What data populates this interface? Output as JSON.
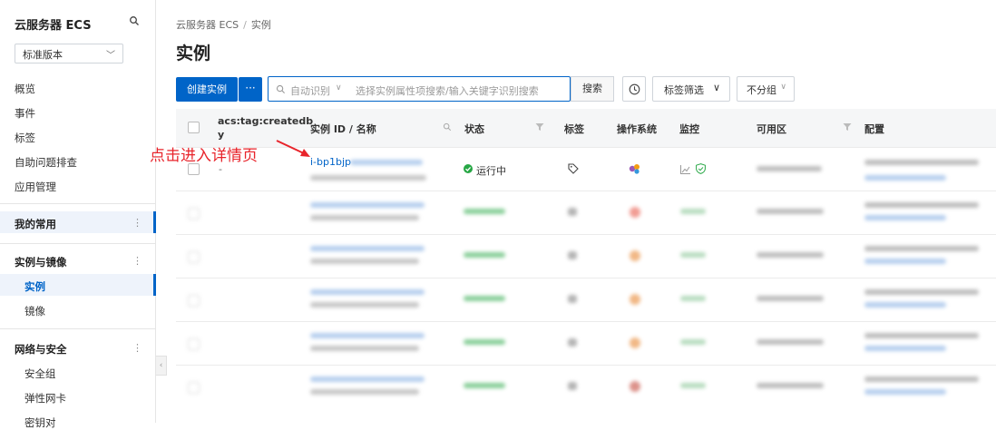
{
  "sidebar": {
    "title": "云服务器 ECS",
    "version_select": "标准版本",
    "items": [
      {
        "label": "概览"
      },
      {
        "label": "事件"
      },
      {
        "label": "标签"
      },
      {
        "label": "自助问题排查"
      },
      {
        "label": "应用管理"
      }
    ],
    "groups": [
      {
        "label": "我的常用"
      },
      {
        "label": "实例与镜像",
        "children": [
          {
            "label": "实例"
          },
          {
            "label": "镜像"
          }
        ]
      },
      {
        "label": "网络与安全",
        "children": [
          {
            "label": "安全组"
          },
          {
            "label": "弹性网卡"
          },
          {
            "label": "密钥对"
          }
        ]
      }
    ]
  },
  "breadcrumb": {
    "root": "云服务器 ECS",
    "current": "实例"
  },
  "page_title": "实例",
  "toolbar": {
    "create_label": "创建实例",
    "more_label": "···",
    "search_mode": "自动识别",
    "search_placeholder": "选择实例属性项搜索/输入关键字识别搜索",
    "search_button": "搜索",
    "tag_filter": "标签筛选",
    "group_select": "不分组"
  },
  "table": {
    "headers": {
      "tag": "acs:tag:createdb",
      "tag_wrap": "y",
      "id_name": "实例 ID / 名称",
      "status": "状态",
      "labels": "标签",
      "os": "操作系统",
      "monitor": "监控",
      "zone": "可用区",
      "config": "配置"
    },
    "first_row": {
      "tag_value": "-",
      "instance_id": "i-bp1bjp",
      "status": "运行中"
    }
  },
  "annotation": "点击进入详情页",
  "colors": {
    "primary": "#0064c8",
    "annotation": "#e8242b",
    "running": "#27a745"
  }
}
